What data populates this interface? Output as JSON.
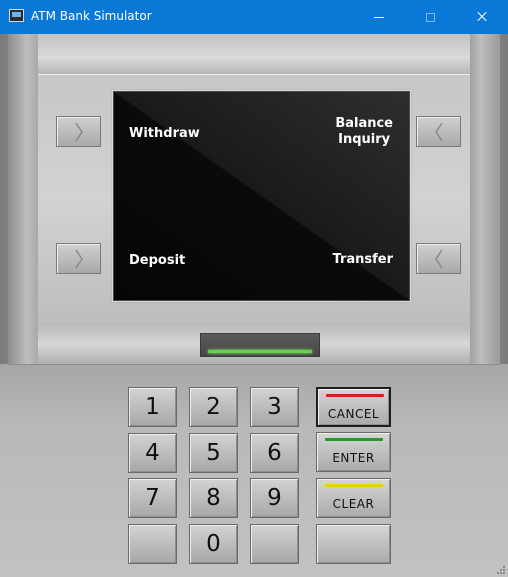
{
  "window": {
    "title": "ATM Bank Simulator",
    "app_icon": "atm-icon",
    "title_bar_color": "#0a78d7"
  },
  "screen": {
    "top_left": "Withdraw",
    "top_right_line1": "Balance",
    "top_right_line2": "Inquiry",
    "bottom_left": "Deposit",
    "bottom_right": "Transfer"
  },
  "side_buttons": {
    "left_icon": "chevron-right-icon",
    "right_icon": "chevron-left-icon"
  },
  "card_slot": {
    "indicator_color": "#63d24a"
  },
  "keypad": {
    "keys": [
      "1",
      "2",
      "3",
      "4",
      "5",
      "6",
      "7",
      "8",
      "9",
      "",
      "0",
      ""
    ],
    "function_keys": [
      {
        "label": "CANCEL",
        "color": "#d21f1f"
      },
      {
        "label": "ENTER",
        "color": "#229a2b"
      },
      {
        "label": "CLEAR",
        "color": "#e8d200"
      },
      {
        "label": "",
        "color": ""
      }
    ]
  }
}
